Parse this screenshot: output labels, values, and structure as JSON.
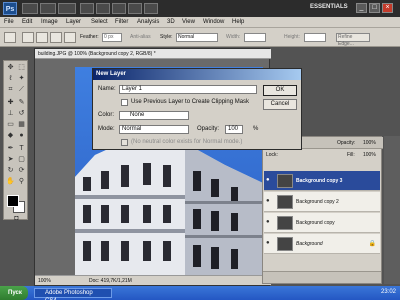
{
  "window": {
    "workspace": "ESSENTIALS",
    "controls": [
      "_",
      "□",
      "×"
    ],
    "logo": "Ps"
  },
  "menu": {
    "items": [
      "File",
      "Edit",
      "Image",
      "Layer",
      "Select",
      "Filter",
      "Analysis",
      "3D",
      "View",
      "Window",
      "Help"
    ]
  },
  "options": {
    "feather_label": "Feather:",
    "feather_value": "0 px",
    "antialias_label": "Anti-alias",
    "style_label": "Style:",
    "style_value": "Normal",
    "width_label": "Width:",
    "height_label": "Height:",
    "refine_label": "Refine Edge..."
  },
  "document": {
    "tab_title": "building.JPG @ 100% (Background copy 2, RGB/8) *",
    "zoom": "100%",
    "doc_size": "Doc: 419,7K/1,21M"
  },
  "dialog": {
    "title": "New Layer",
    "name_label": "Name:",
    "name_value": "Layer 1",
    "clip_label": "Use Previous Layer to Create Clipping Mask",
    "color_label": "Color:",
    "color_value": "None",
    "mode_label": "Mode:",
    "mode_value": "Normal",
    "opacity_label": "Opacity:",
    "opacity_value": "100",
    "opacity_unit": "%",
    "neutral_label": "(No neutral color exists for Normal mode.)",
    "ok": "OK",
    "cancel": "Cancel"
  },
  "layers_panel": {
    "opacity_label": "Opacity:",
    "opacity_value": "100%",
    "fill_label": "Fill:",
    "fill_value": "100%",
    "lock_label": "Lock:",
    "layers": [
      {
        "name": "Background copy 3",
        "selected": true
      },
      {
        "name": "Background copy 2",
        "selected": false
      },
      {
        "name": "Background copy",
        "selected": false
      },
      {
        "name": "Background",
        "selected": false,
        "locked": true
      }
    ]
  },
  "taskbar": {
    "start_label": "Пуск",
    "task_label": "Adobe Photoshop CS4...",
    "time": "23:02"
  }
}
